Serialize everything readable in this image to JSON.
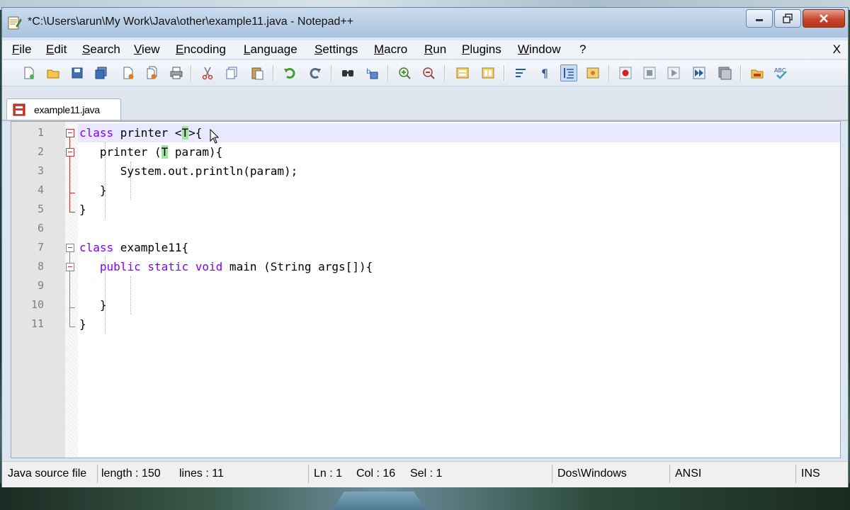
{
  "window": {
    "title": "*C:\\Users\\arun\\My Work\\Java\\other\\example11.java - Notepad++"
  },
  "menu": {
    "items": [
      "File",
      "Edit",
      "Search",
      "View",
      "Encoding",
      "Language",
      "Settings",
      "Macro",
      "Run",
      "Plugins",
      "Window",
      "?"
    ],
    "close_label": "X"
  },
  "toolbar": {
    "icons": [
      "new-file-icon",
      "open-file-icon",
      "save-icon",
      "save-all-icon",
      "close-icon",
      "close-all-icon",
      "print-icon",
      "cut-icon",
      "copy-icon",
      "paste-icon",
      "undo-icon",
      "redo-icon",
      "find-icon",
      "replace-icon",
      "zoom-in-icon",
      "zoom-out-icon",
      "sync-vertical-icon",
      "sync-horizontal-icon",
      "word-wrap-icon",
      "show-all-characters-icon",
      "indent-guide-icon",
      "user-defined-language-icon",
      "record-macro-icon",
      "stop-macro-icon",
      "play-macro-icon",
      "run-macro-multiple-icon",
      "save-macro-icon",
      "folder-icon",
      "spellcheck-icon"
    ]
  },
  "tab": {
    "label": "example11.java"
  },
  "editor": {
    "lines": [
      {
        "n": "1",
        "text": "class printer <T>{"
      },
      {
        "n": "2",
        "text": "   printer (T param){"
      },
      {
        "n": "3",
        "text": "      System.out.println(param);"
      },
      {
        "n": "4",
        "text": "   }"
      },
      {
        "n": "5",
        "text": "}"
      },
      {
        "n": "6",
        "text": ""
      },
      {
        "n": "7",
        "text": "class example11{"
      },
      {
        "n": "8",
        "text": "   public static void main (String args[]){"
      },
      {
        "n": "9",
        "text": ""
      },
      {
        "n": "10",
        "text": "   }"
      },
      {
        "n": "11",
        "text": "}"
      }
    ]
  },
  "status": {
    "file_type": "Java source file",
    "length": "length : 150",
    "lines": "lines : 11",
    "ln": "Ln : 1",
    "col": "Col : 16",
    "sel": "Sel : 1",
    "eol": "Dos\\Windows",
    "encoding": "ANSI",
    "mode": "INS"
  },
  "colors": {
    "keyword": "#8000ff",
    "brace_match": "#a0e4a0",
    "fold_marker": "#cc3333",
    "current_line": "#e8e8ff"
  }
}
